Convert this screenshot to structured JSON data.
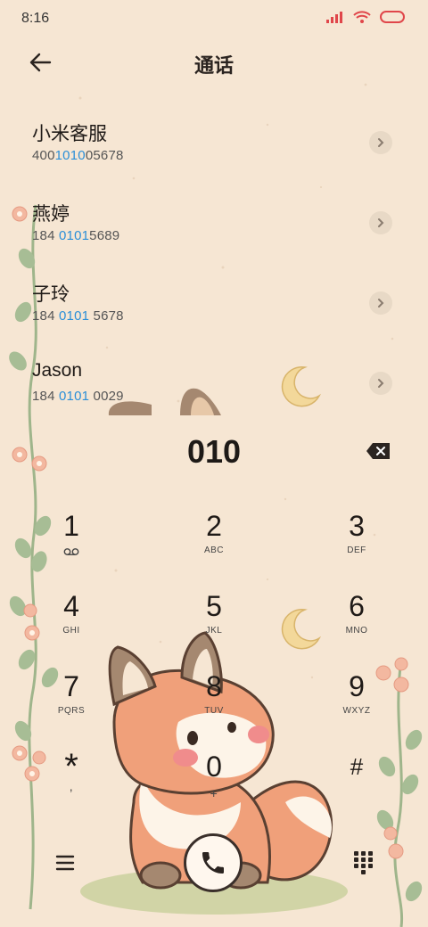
{
  "status_bar": {
    "time": "8:16"
  },
  "header": {
    "title": "通话"
  },
  "contacts": [
    {
      "name": "小米客服",
      "number_parts": [
        "400",
        "1010",
        "05678"
      ]
    },
    {
      "name": "燕婷",
      "number_parts": [
        "184 ",
        "0101",
        "5689"
      ]
    },
    {
      "name": "子玲",
      "number_parts": [
        "184 ",
        "0101",
        " 5678"
      ]
    },
    {
      "name": "Jason",
      "number_parts": [
        "184 ",
        "0101",
        " 0029"
      ]
    }
  ],
  "dialer": {
    "entered_number": "010"
  },
  "keypad": [
    {
      "digit": "1",
      "letters": ""
    },
    {
      "digit": "2",
      "letters": "ABC"
    },
    {
      "digit": "3",
      "letters": "DEF"
    },
    {
      "digit": "4",
      "letters": "GHI"
    },
    {
      "digit": "5",
      "letters": "JKL"
    },
    {
      "digit": "6",
      "letters": "MNO"
    },
    {
      "digit": "7",
      "letters": "PQRS"
    },
    {
      "digit": "8",
      "letters": "TUV"
    },
    {
      "digit": "9",
      "letters": "WXYZ"
    },
    {
      "digit": "*",
      "letters": ","
    },
    {
      "digit": "0",
      "letters": "+"
    },
    {
      "digit": "#",
      "letters": ""
    }
  ],
  "colors": {
    "background": "#f6e6d3",
    "highlight": "#2b8fd8",
    "fox_orange": "#f0a07a",
    "moon": "#f3d89a",
    "flower": "#f3b8a0",
    "leaf": "#a7bd95"
  },
  "icons": {
    "back": "arrow-left-icon",
    "chevron": "chevron-right-icon",
    "backspace": "backspace-icon",
    "voicemail": "voicemail-icon",
    "menu": "menu-icon",
    "call": "phone-icon",
    "dialpad": "dialpad-icon"
  }
}
